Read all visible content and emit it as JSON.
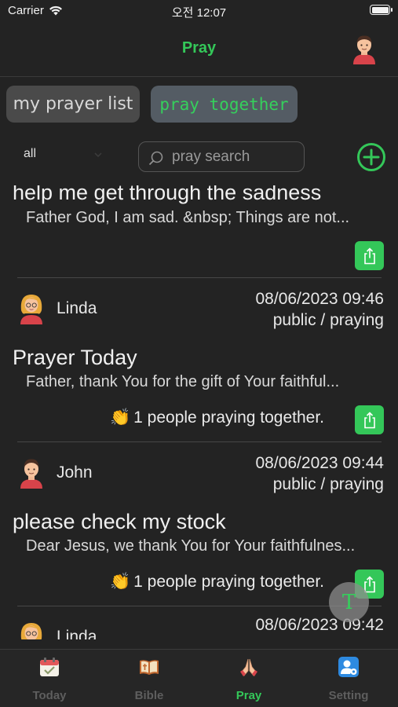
{
  "status": {
    "carrier": "Carrier",
    "time": "오전 12:07"
  },
  "header": {
    "title": "Pray"
  },
  "segments": {
    "mine": "my prayer list",
    "together": "pray together"
  },
  "filter": {
    "selected": "all"
  },
  "search": {
    "placeholder": "pray search"
  },
  "prayers": [
    {
      "title": "help me get through the sadness",
      "body": "Father God, I am sad. &nbsp;  Things are not..."
    },
    {
      "author": "Linda",
      "date": "08/06/2023 09:46",
      "visibility": "public",
      "state": "praying",
      "title": "Prayer Today",
      "body": "Father, thank You for the gift of Your faithful...",
      "praying": "1 people praying together."
    },
    {
      "author": "John",
      "date": "08/06/2023 09:44",
      "visibility": "public",
      "state": "praying",
      "title": "please check my stock",
      "body": "Dear Jesus, we thank You for Your faithfulnes...",
      "praying": "1 people praying together."
    },
    {
      "author": "Linda",
      "date": "08/06/2023 09:42"
    }
  ],
  "float_button": {
    "label": "T"
  },
  "tabs": [
    {
      "label": "Today",
      "icon": "calendar-icon"
    },
    {
      "label": "Bible",
      "icon": "bible-icon"
    },
    {
      "label": "Pray",
      "icon": "praying-hands-icon"
    },
    {
      "label": "Setting",
      "icon": "user-settings-icon"
    }
  ],
  "colors": {
    "accent": "#34c759",
    "background": "#232323",
    "segment_active": "#545c64",
    "segment_inactive": "#4a4a4a"
  }
}
